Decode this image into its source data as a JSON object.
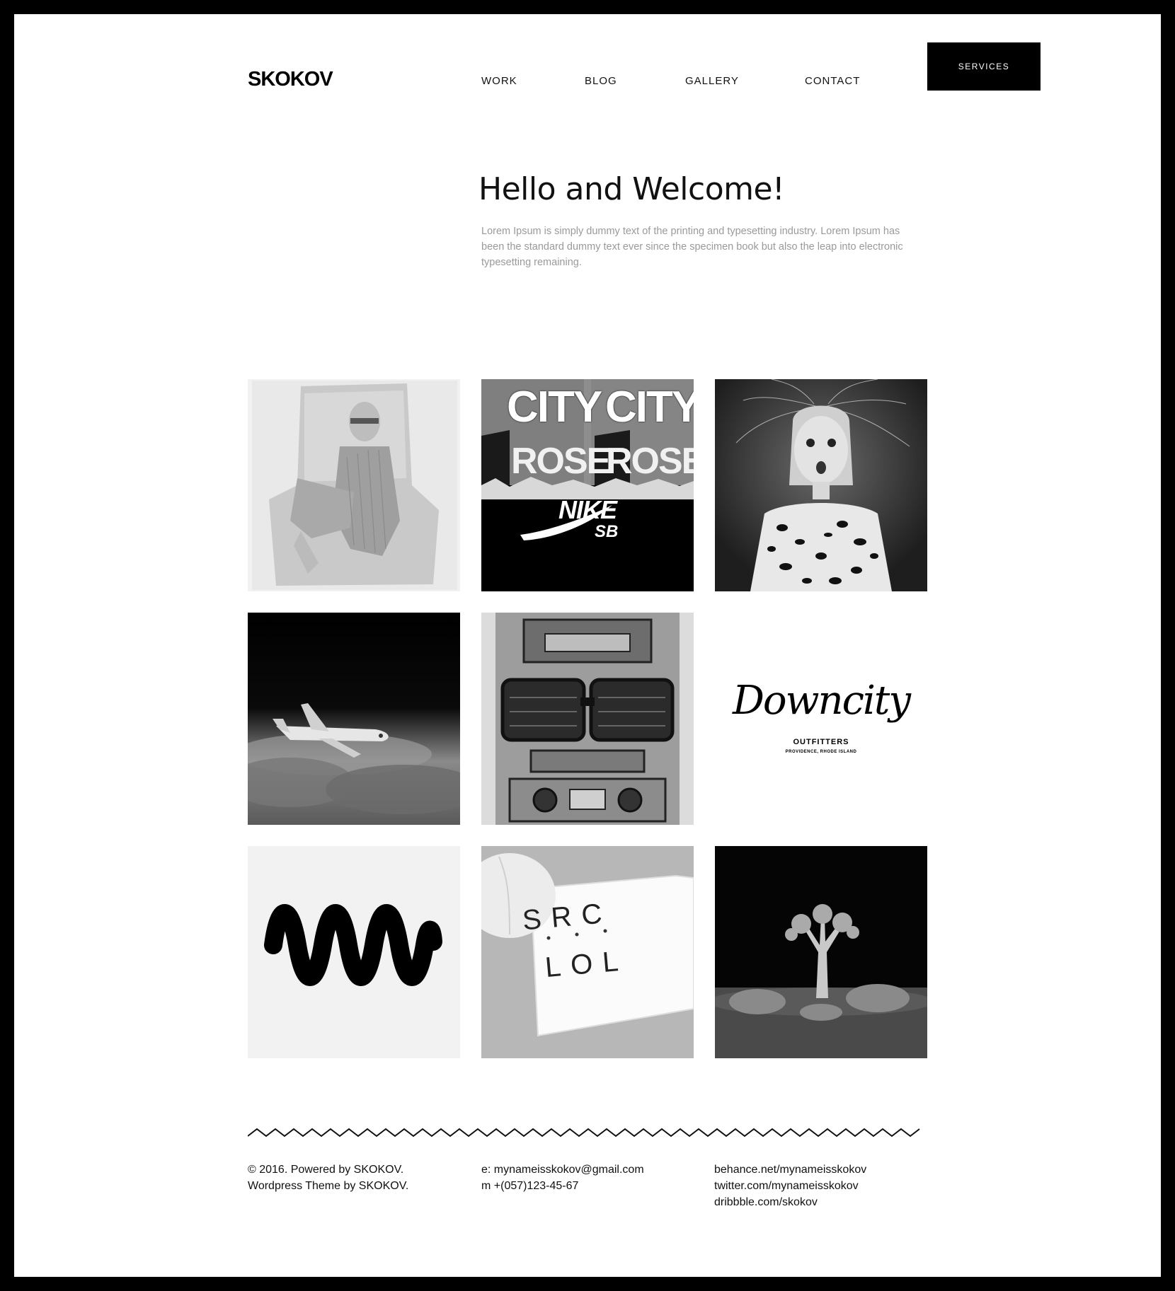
{
  "brand": {
    "logo": "SKOKOV"
  },
  "nav": {
    "items": [
      {
        "label": "WORK"
      },
      {
        "label": "BLOG"
      },
      {
        "label": "GALLERY"
      },
      {
        "label": "CONTACT"
      }
    ],
    "cta_label": "SERVICES"
  },
  "hero": {
    "title": "Hello and Welcome!",
    "text": "Lorem Ipsum is simply dummy text of the printing and typesetting industry. Lorem Ipsum has been the standard dummy text ever since the specimen book but also the leap into electronic typesetting remaining."
  },
  "gallery": {
    "tiles": [
      {
        "subject": "illustration-man-in-armchair"
      },
      {
        "subject": "city-rose-nike-sb-poster",
        "texts": [
          "CITY",
          "ROSE",
          "NIKE",
          "SB"
        ]
      },
      {
        "subject": "portrait-surprised-woman"
      },
      {
        "subject": "toy-plane-in-clouds"
      },
      {
        "subject": "robot-with-sunglasses-illustration"
      },
      {
        "subject": "downcity-outfitters-logo",
        "texts": [
          "Downcity",
          "OUTFITTERS",
          "PROVIDENCE, RHODE ISLAND"
        ]
      },
      {
        "subject": "wave-logo"
      },
      {
        "subject": "src-lol-mousepad",
        "texts": [
          "SRC",
          "LOL"
        ]
      },
      {
        "subject": "joshua-tree-at-night"
      }
    ]
  },
  "footer": {
    "copyright_line1": "© 2016. Powered by SKOKOV.",
    "copyright_line2": "Wordpress Theme by SKOKOV.",
    "email": "e: mynameisskokov@gmail.com",
    "phone": "m +(057)123-45-67",
    "links": [
      "behance.net/mynameisskokov",
      "twitter.com/mynameisskokov",
      "dribbble.com/skokov"
    ]
  },
  "colors": {
    "frame": "#000000",
    "background": "#ffffff",
    "muted_text": "#9a9a9a",
    "button": "#000000"
  }
}
